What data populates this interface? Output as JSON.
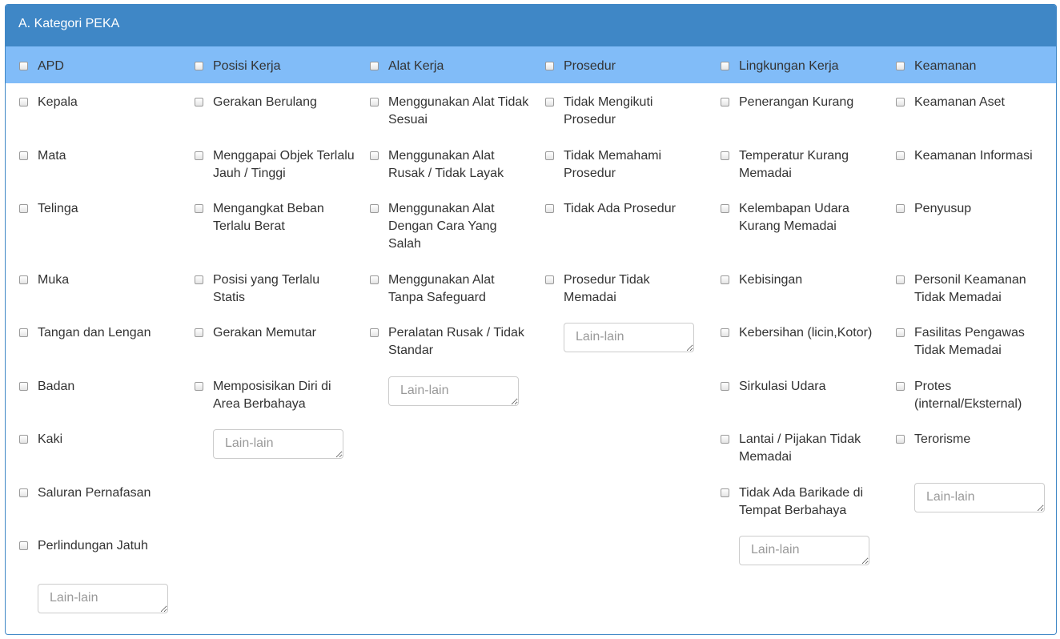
{
  "panel": {
    "title": "A. Kategori PEKA"
  },
  "columns": [
    {
      "header": "APD",
      "items": [
        "Kepala",
        "Mata",
        "Telinga",
        "Muka",
        "Tangan dan Lengan",
        "Badan",
        "Kaki",
        "Saluran Pernafasan",
        "Perlindungan Jatuh"
      ],
      "other_placeholder": "Lain-lain"
    },
    {
      "header": "Posisi Kerja",
      "items": [
        "Gerakan Berulang",
        "Menggapai Objek Terlalu Jauh / Tinggi",
        "Mengangkat Beban Terlalu Berat",
        "Posisi yang Terlalu Statis",
        "Gerakan Memutar",
        "Memposisikan Diri di Area Berbahaya"
      ],
      "other_placeholder": "Lain-lain"
    },
    {
      "header": "Alat Kerja",
      "items": [
        "Menggunakan Alat Tidak Sesuai",
        "Menggunakan Alat Rusak / Tidak Layak",
        "Menggunakan Alat Dengan Cara Yang Salah",
        "Menggunakan Alat Tanpa Safeguard",
        "Peralatan Rusak / Tidak Standar"
      ],
      "other_placeholder": "Lain-lain"
    },
    {
      "header": "Prosedur",
      "items": [
        "Tidak Mengikuti Prosedur",
        "Tidak Memahami Prosedur",
        "Tidak Ada Prosedur",
        "Prosedur Tidak Memadai"
      ],
      "other_placeholder": "Lain-lain"
    },
    {
      "header": "Lingkungan Kerja",
      "items": [
        "Penerangan Kurang",
        "Temperatur Kurang Memadai",
        "Kelembapan Udara Kurang Memadai",
        "Kebisingan",
        "Kebersihan (licin,Kotor)",
        "Sirkulasi Udara",
        "Lantai / Pijakan Tidak Memadai",
        "Tidak Ada Barikade di Tempat Berbahaya"
      ],
      "other_placeholder": "Lain-lain"
    },
    {
      "header": "Keamanan",
      "items": [
        "Keamanan Aset",
        "Keamanan Informasi",
        "Penyusup",
        "Personil Keamanan Tidak Memadai",
        "Fasilitas Pengawas Tidak Memadai",
        "Protes (internal/Eksternal)",
        "Terorisme"
      ],
      "other_placeholder": "Lain-lain"
    }
  ]
}
